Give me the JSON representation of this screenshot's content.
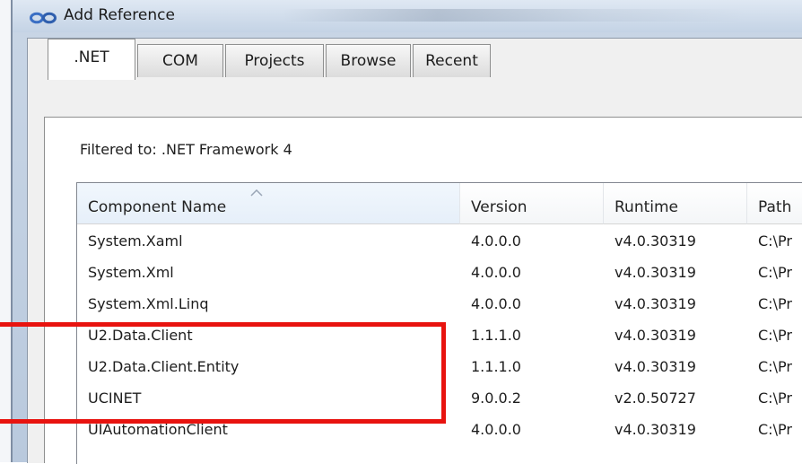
{
  "window": {
    "title": "Add Reference"
  },
  "tabs": [
    {
      "label": ".NET",
      "active": true
    },
    {
      "label": "COM",
      "active": false
    },
    {
      "label": "Projects",
      "active": false
    },
    {
      "label": "Browse",
      "active": false
    },
    {
      "label": "Recent",
      "active": false
    }
  ],
  "filter": {
    "label": "Filtered to: .NET Framework 4"
  },
  "list": {
    "columns": [
      "Component Name",
      "Version",
      "Runtime",
      "Path"
    ],
    "sorted_column": "Component Name",
    "rows": [
      {
        "name": "System.Xaml",
        "version": "4.0.0.0",
        "runtime": "v4.0.30319",
        "path": "C:\\Pr"
      },
      {
        "name": "System.Xml",
        "version": "4.0.0.0",
        "runtime": "v4.0.30319",
        "path": "C:\\Pr"
      },
      {
        "name": "System.Xml.Linq",
        "version": "4.0.0.0",
        "runtime": "v4.0.30319",
        "path": "C:\\Pr"
      },
      {
        "name": "U2.Data.Client",
        "version": "1.1.1.0",
        "runtime": "v4.0.30319",
        "path": "C:\\Pr"
      },
      {
        "name": "U2.Data.Client.Entity",
        "version": "1.1.1.0",
        "runtime": "v4.0.30319",
        "path": "C:\\Pr"
      },
      {
        "name": "UCINET",
        "version": "9.0.0.2",
        "runtime": "v2.0.50727",
        "path": "C:\\Pr"
      },
      {
        "name": "UIAutomationClient",
        "version": "4.0.0.0",
        "runtime": "v4.0.30319",
        "path": "C:\\Pr"
      }
    ]
  },
  "colors": {
    "highlight": "#e8130f",
    "tab_border": "#8e8f8f",
    "title_bar": "#c4d3e5"
  },
  "icons": {
    "window": "infinity-icon",
    "sort": "sort-ascending-icon"
  }
}
